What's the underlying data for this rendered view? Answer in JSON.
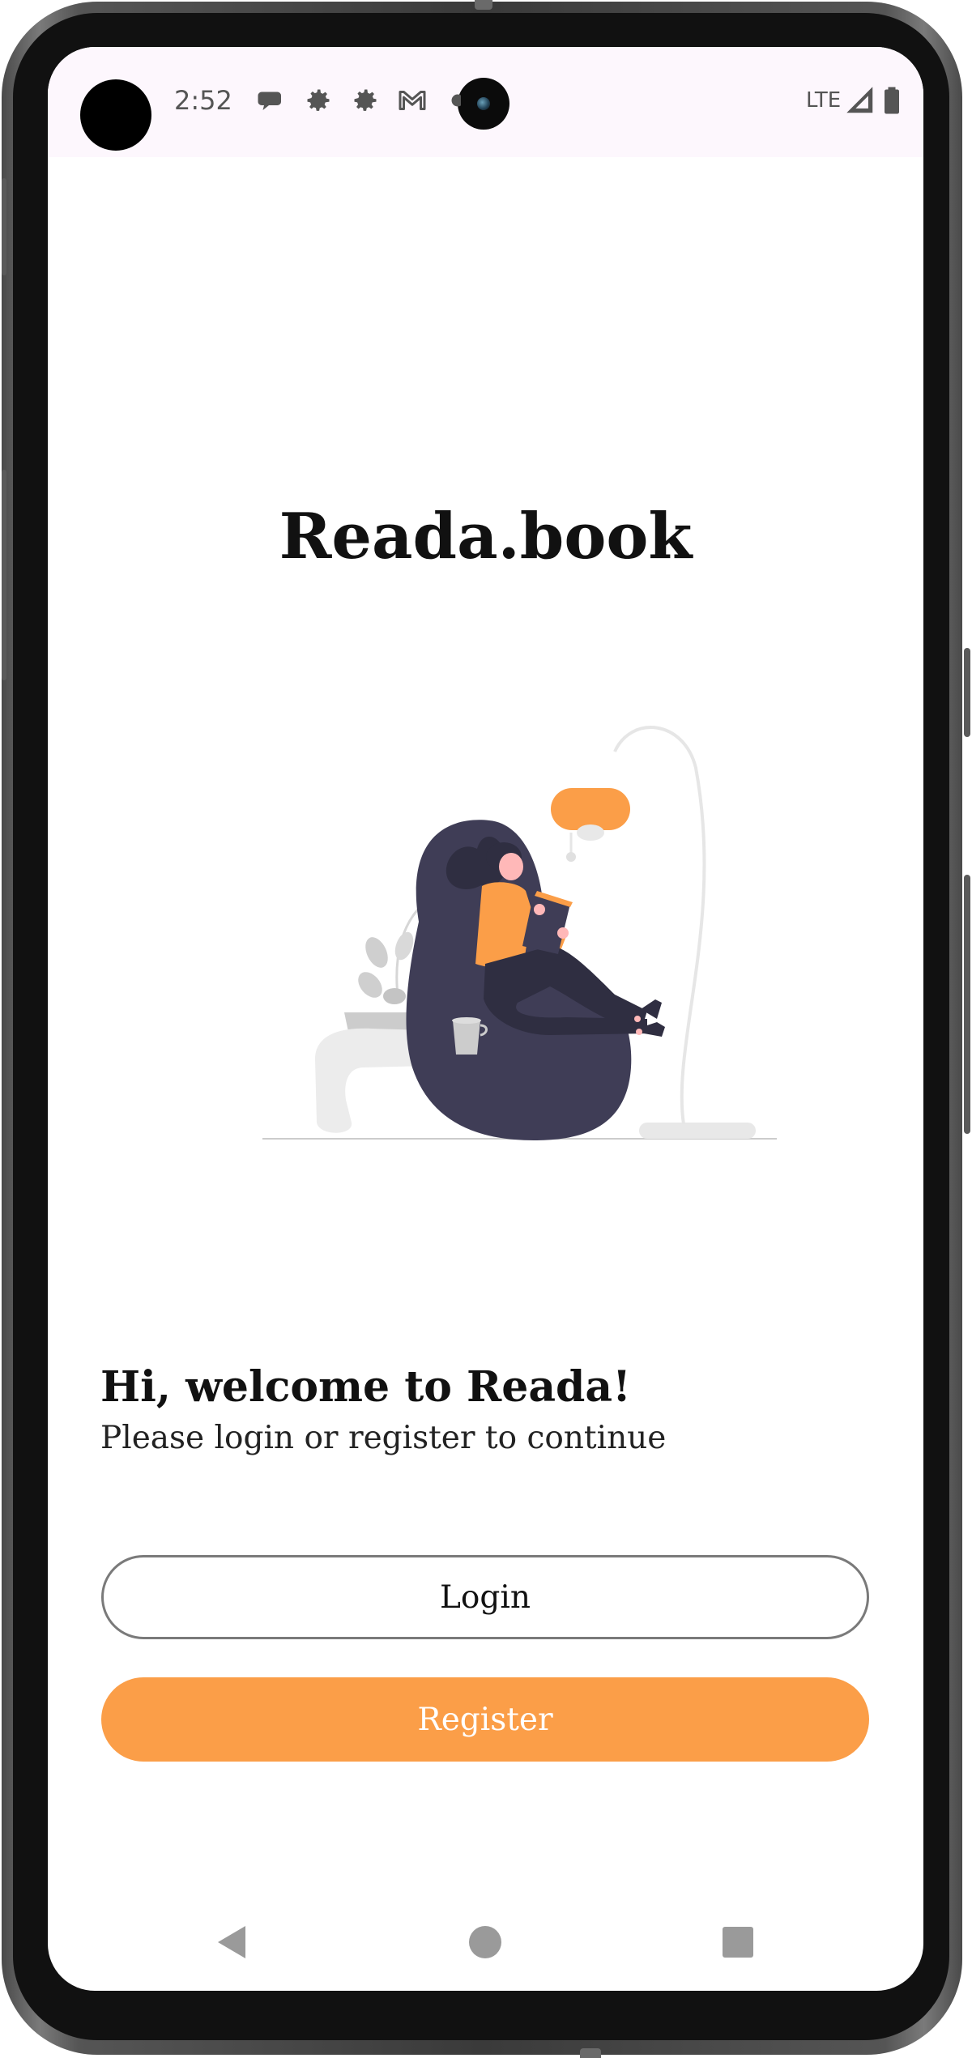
{
  "status_bar": {
    "time": "2:52",
    "network": "LTE",
    "icons": [
      "chat-bubble-icon",
      "settings-icon",
      "settings-icon",
      "gmail-icon",
      "signal-icon",
      "battery-icon"
    ]
  },
  "app": {
    "title": "Reada.book"
  },
  "welcome": {
    "title": "Hi, welcome to Reada!",
    "subtitle": "Please login or register to continue"
  },
  "buttons": {
    "login_label": "Login",
    "register_label": "Register"
  },
  "nav": {
    "icons": [
      "back-icon",
      "home-icon",
      "recents-icon"
    ]
  },
  "colors": {
    "accent": "#fb9e48",
    "status_bar_bg": "#fdf7fd",
    "illustration_dark": "#3f3d56"
  }
}
